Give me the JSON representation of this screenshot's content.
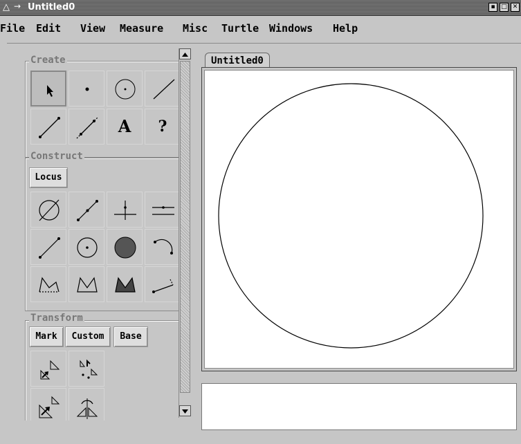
{
  "window": {
    "title": "Untitled0",
    "controls": [
      "minimize",
      "maximize",
      "close"
    ]
  },
  "menu": [
    "File",
    "Edit",
    "View",
    "Measure",
    "Misc",
    "Turtle",
    "Windows",
    "Help"
  ],
  "panel": {
    "create": {
      "label": "Create",
      "tools": [
        "pointer-icon",
        "point-icon",
        "circle-icon",
        "segment-icon",
        "ray-icon",
        "line-icon",
        "text-icon",
        "help-icon"
      ],
      "text_tool_glyph": "A",
      "help_tool_glyph": "?"
    },
    "construct": {
      "label": "Construct",
      "locus_label": "Locus",
      "tools": [
        "intersection-icon",
        "midpoint-icon",
        "perpendicular-icon",
        "parallel-icon",
        "segment-construct-icon",
        "circle-construct-icon",
        "disk-icon",
        "arc-icon",
        "polyline-icon",
        "polygon-icon",
        "filled-polygon-icon",
        "vector-icon"
      ]
    },
    "transform": {
      "label": "Transform",
      "buttons": {
        "mark": "Mark",
        "custom": "Custom",
        "base": "Base"
      },
      "tools": [
        "translate-icon",
        "rotate-icon",
        "dilate-icon",
        "reflect-icon"
      ]
    }
  },
  "document": {
    "tab_label": "Untitled0"
  }
}
